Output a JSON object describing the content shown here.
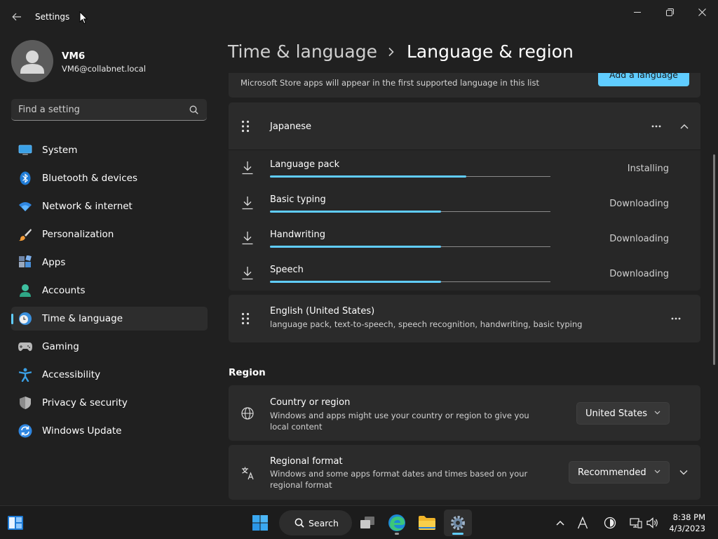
{
  "window": {
    "title": "Settings"
  },
  "user": {
    "name": "VM6",
    "email": "VM6@collabnet.local"
  },
  "search": {
    "placeholder": "Find a setting"
  },
  "sidebar": {
    "items": [
      {
        "label": "System",
        "icon": "monitor-icon",
        "selected": false
      },
      {
        "label": "Bluetooth & devices",
        "icon": "bluetooth-icon",
        "selected": false
      },
      {
        "label": "Network & internet",
        "icon": "wifi-icon",
        "selected": false
      },
      {
        "label": "Personalization",
        "icon": "brush-icon",
        "selected": false
      },
      {
        "label": "Apps",
        "icon": "apps-icon",
        "selected": false
      },
      {
        "label": "Accounts",
        "icon": "person-icon",
        "selected": false
      },
      {
        "label": "Time & language",
        "icon": "clock-globe-icon",
        "selected": true
      },
      {
        "label": "Gaming",
        "icon": "gamepad-icon",
        "selected": false
      },
      {
        "label": "Accessibility",
        "icon": "accessibility-icon",
        "selected": false
      },
      {
        "label": "Privacy & security",
        "icon": "shield-icon",
        "selected": false
      },
      {
        "label": "Windows Update",
        "icon": "update-icon",
        "selected": false
      }
    ]
  },
  "header": {
    "parent": "Time & language",
    "current": "Language & region"
  },
  "languages": {
    "top_desc": "Microsoft Store apps will appear in the first supported language in this list",
    "add_button": "Add a language",
    "japanese": {
      "name": "Japanese",
      "features": [
        {
          "name": "Language pack",
          "status": "Installing",
          "progress": 0.7
        },
        {
          "name": "Basic typing",
          "status": "Downloading",
          "progress": 0.61
        },
        {
          "name": "Handwriting",
          "status": "Downloading",
          "progress": 0.61
        },
        {
          "name": "Speech",
          "status": "Downloading",
          "progress": 0.61
        }
      ]
    },
    "english": {
      "name": "English (United States)",
      "desc": "language pack, text-to-speech, speech recognition, handwriting, basic typing"
    }
  },
  "region": {
    "title": "Region",
    "country": {
      "title": "Country or region",
      "desc": "Windows and apps might use your country or region to give you local content",
      "value": "United States"
    },
    "format": {
      "title": "Regional format",
      "desc": "Windows and some apps format dates and times based on your regional format",
      "value": "Recommended"
    }
  },
  "taskbar": {
    "search_label": "Search",
    "time": "8:38 PM",
    "date": "4/3/2023"
  },
  "colors": {
    "accent": "#60cdff",
    "background": "#202020",
    "card": "#2b2b2b"
  }
}
